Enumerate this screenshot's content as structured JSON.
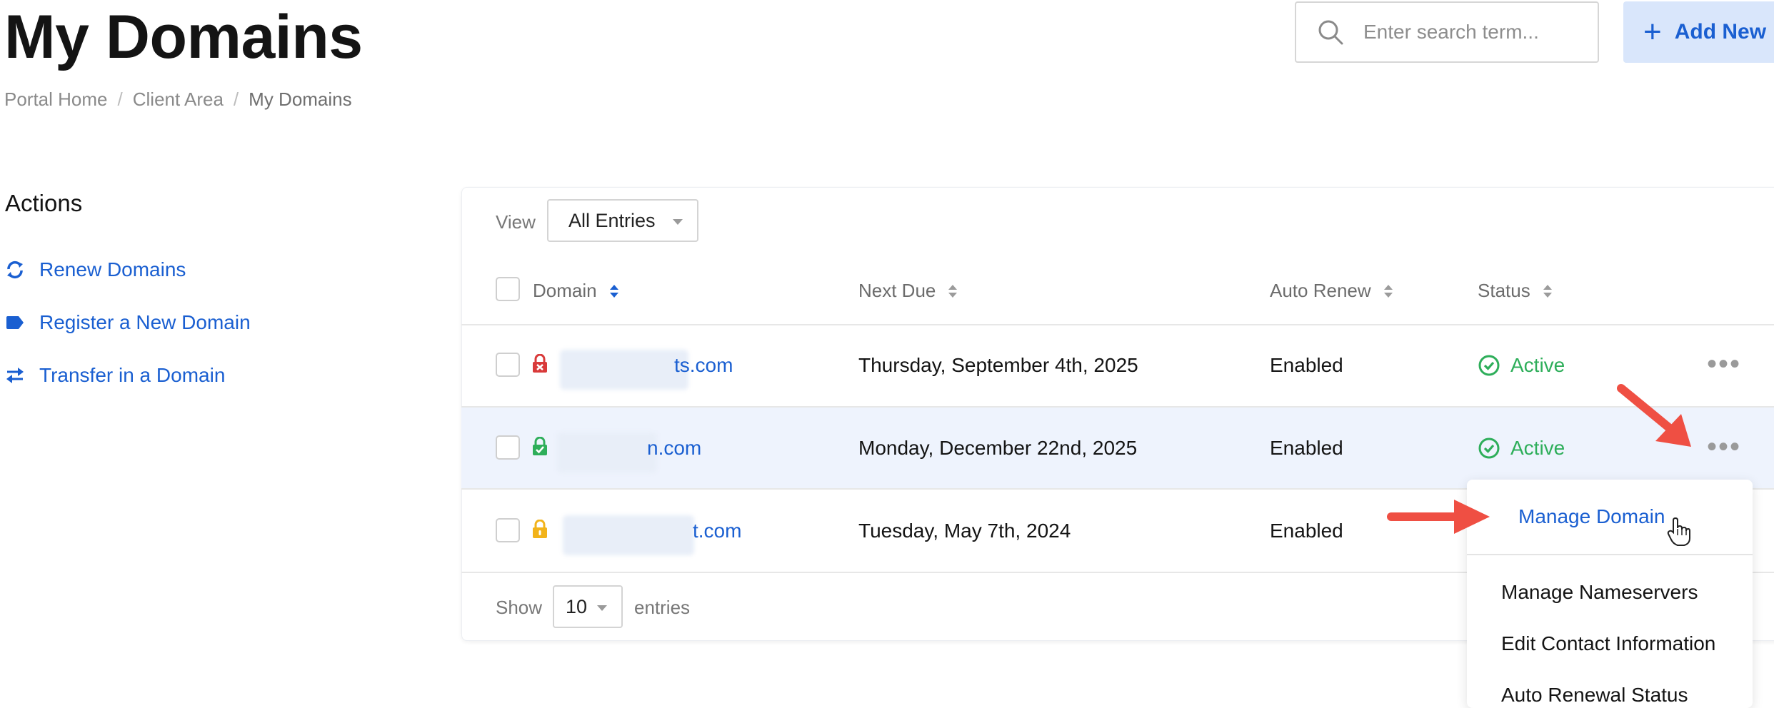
{
  "header": {
    "title": "My Domains",
    "breadcrumb": [
      "Portal Home",
      "Client Area",
      "My Domains"
    ],
    "search_placeholder": "Enter search term...",
    "add_new_label": "Add New"
  },
  "sidebar": {
    "title": "Actions",
    "items": [
      {
        "label": "Renew Domains",
        "icon": "renew-icon"
      },
      {
        "label": "Register a New Domain",
        "icon": "tag-icon"
      },
      {
        "label": "Transfer in a Domain",
        "icon": "transfer-icon"
      }
    ]
  },
  "table": {
    "view_label": "View",
    "view_value": "All Entries",
    "columns": [
      "Domain",
      "Next Due",
      "Auto Renew",
      "Status"
    ],
    "rows": [
      {
        "domain": "ts.com",
        "lock": "red",
        "next_due": "Thursday, September 4th, 2025",
        "auto_renew": "Enabled",
        "status": "Active"
      },
      {
        "domain": "n.com",
        "lock": "green",
        "next_due": "Monday, December 22nd, 2025",
        "auto_renew": "Enabled",
        "status": "Active"
      },
      {
        "domain": "t.com",
        "lock": "yellow",
        "next_due": "Tuesday, May 7th, 2024",
        "auto_renew": "Enabled",
        "status": ""
      }
    ],
    "show_label": "Show",
    "page_size": "10",
    "entries_label": "entries"
  },
  "menu": {
    "items": [
      "Manage Domain",
      "Manage Nameservers",
      "Edit Contact Information",
      "Auto Renewal Status"
    ]
  },
  "colors": {
    "accent": "#1a5fd1",
    "active_green": "#2eae5a",
    "lock_red": "#d93a3a",
    "lock_green": "#2eae5a",
    "lock_yellow": "#f2b31a",
    "arrow": "#ef4f43",
    "highlight_row": "#eef3fd"
  }
}
